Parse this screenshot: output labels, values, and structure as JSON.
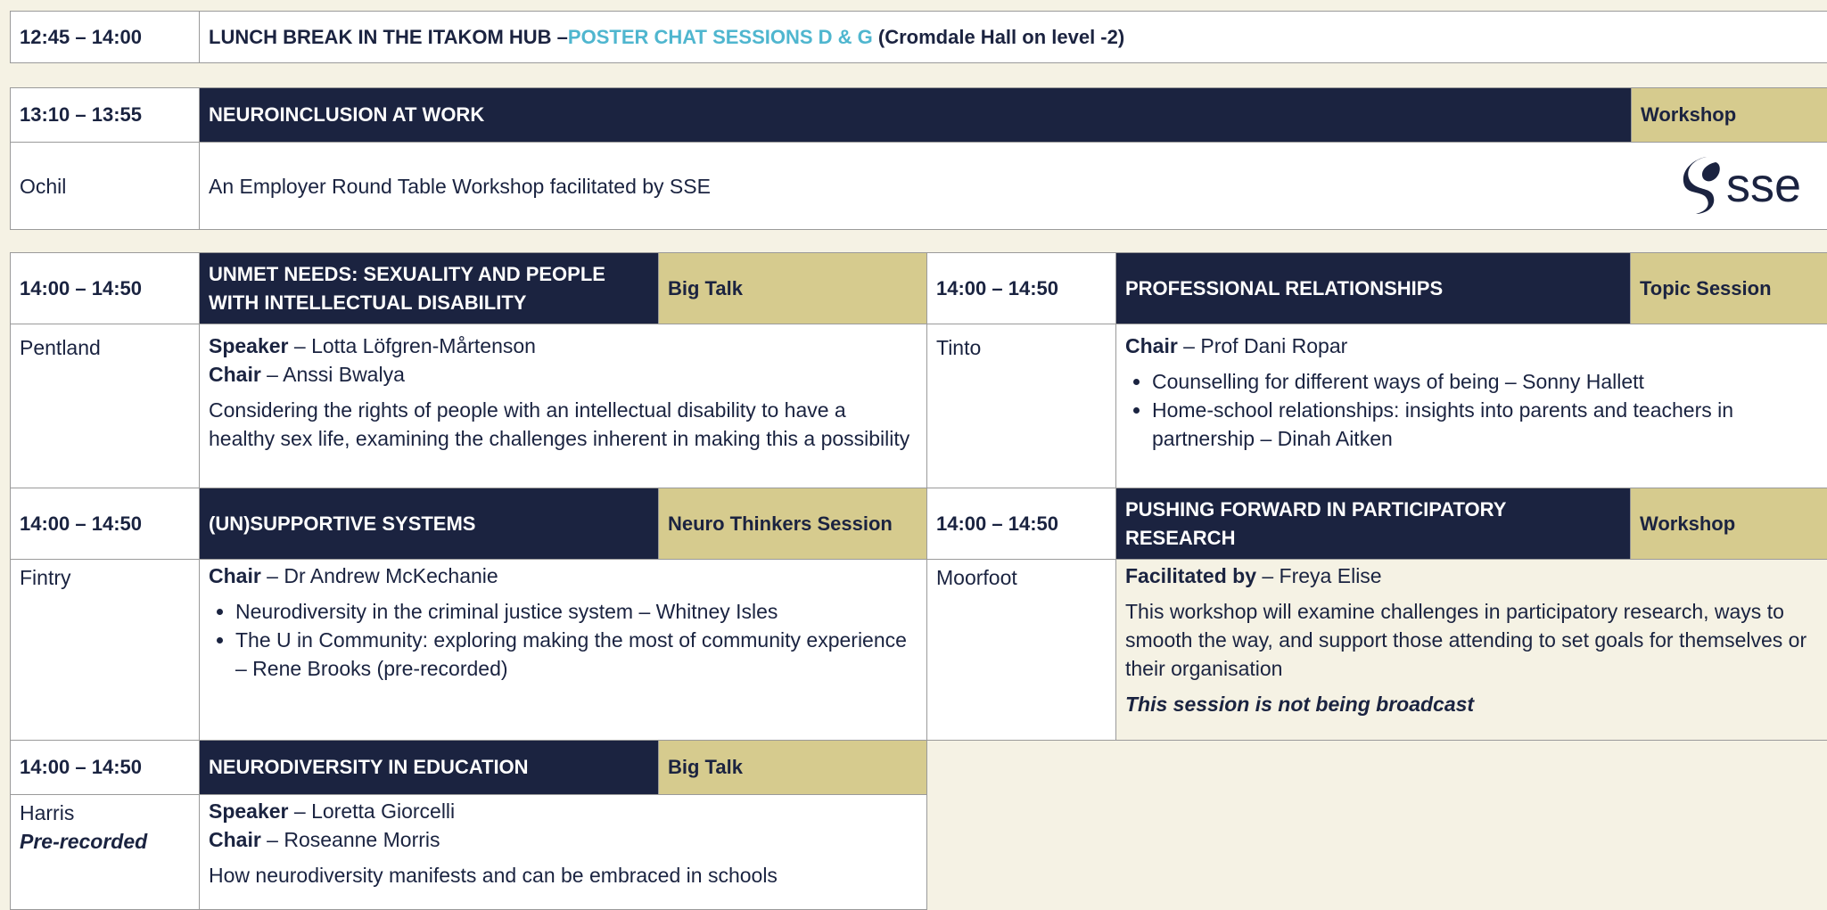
{
  "lunch": {
    "time": "12:45 – 14:00",
    "title_a": "LUNCH BREAK IN THE ITAKOM HUB – ",
    "title_b": "POSTER CHAT SESSIONS D & G",
    "title_c": " (Cromdale Hall on level -2)"
  },
  "neuroinclusion": {
    "time": "13:10 – 13:55",
    "title": "NEUROINCLUSION AT WORK",
    "type": "Workshop",
    "room": "Ochil",
    "description": "An Employer Round Table Workshop facilitated by SSE",
    "logo_text": "sse"
  },
  "unmet_needs": {
    "time": "14:00 – 14:50",
    "title_line1": "UNMET NEEDS: SEXUALITY AND PEOPLE",
    "title_line2": "WITH INTELLECTUAL DISABILITY",
    "type": "Big Talk",
    "room": "Pentland",
    "speaker_label": "Speaker",
    "speaker": " – Lotta Löfgren-Mårtenson",
    "chair_label": "Chair",
    "chair": " – Anssi Bwalya",
    "description": "Considering the rights of people with an intellectual disability to have a healthy sex life, examining the challenges inherent in making this a possibility"
  },
  "professional": {
    "time": "14:00 – 14:50",
    "title": "PROFESSIONAL RELATIONSHIPS",
    "type": "Topic Session",
    "room": "Tinto",
    "chair_label": "Chair",
    "chair": " – Prof Dani Ropar",
    "items": [
      "Counselling for different ways of being – Sonny Hallett",
      "Home-school relationships: insights into parents and teachers in partnership – Dinah Aitken"
    ]
  },
  "unsupportive": {
    "time": "14:00 – 14:50",
    "title": "(UN)SUPPORTIVE SYSTEMS",
    "type": "Neuro Thinkers Session",
    "room": "Fintry",
    "chair_label": "Chair",
    "chair": " – Dr Andrew McKechanie",
    "items": [
      "Neurodiversity in the criminal justice system – Whitney Isles",
      "The U in Community: exploring making the most of community experience – Rene Brooks (pre-recorded)"
    ]
  },
  "participatory": {
    "time": "14:00 – 14:50",
    "title_line1": "PUSHING FORWARD IN PARTICIPATORY",
    "title_line2": "RESEARCH",
    "type": "Workshop",
    "room": "Moorfoot",
    "facilitated_label": "Facilitated by",
    "facilitated": " – Freya Elise",
    "description": "This workshop will examine challenges in participatory research, ways to smooth the way, and support those attending to set goals for themselves or their organisation",
    "note": "This session is not being broadcast"
  },
  "education": {
    "time": "14:00 – 14:50",
    "title": "NEURODIVERSITY IN EDUCATION",
    "type": "Big Talk",
    "room": "Harris",
    "room_note": "Pre-recorded",
    "speaker_label": "Speaker",
    "speaker": " – Loretta Giorcelli",
    "chair_label": "Chair",
    "chair": " – Roseanne Morris",
    "description": "How neurodiversity manifests and can be embraced in schools"
  },
  "colors": {
    "navy": "#1b2340",
    "tan": "#d6cb8e",
    "teal": "#4fb6cf",
    "cream": "#f5f2e4"
  }
}
